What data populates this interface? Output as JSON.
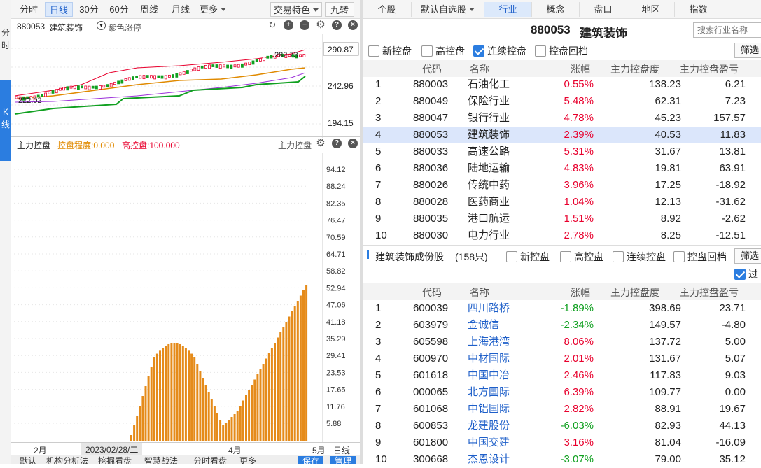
{
  "sidebar": {
    "top_label_1": "分",
    "top_label_2": "时",
    "k_label_1": "K",
    "k_label_2": "线"
  },
  "period_tabs": [
    "分时",
    "日线",
    "30分",
    "60分",
    "周线",
    "月线",
    "更多"
  ],
  "period_active": "日线",
  "period_right": {
    "feature": "交易特色",
    "nine": "九转"
  },
  "kpanel": {
    "code": "880053",
    "name": "建筑装饰",
    "toggle": "紫色涨停",
    "price_top": "290.87",
    "price_mid": "242.96",
    "price_low": "194.15",
    "high_label": "282.73",
    "low_label": "222.02"
  },
  "indicator": {
    "name": "主力控盘",
    "degree": "控盘程度:0.000",
    "high": "高控盘:100.000",
    "right_label": "主力控盘",
    "scale": [
      "94.12",
      "88.24",
      "82.35",
      "76.47",
      "70.59",
      "64.71",
      "58.82",
      "52.94",
      "47.06",
      "41.18",
      "35.29",
      "29.41",
      "23.53",
      "17.65",
      "11.76",
      "5.88"
    ]
  },
  "date_axis": {
    "feb": "2月",
    "cursor": "2023/02/28/二",
    "apr": "4月",
    "may": "5月",
    "period": "日线"
  },
  "bottom_tabs": [
    "默认",
    "机构分析法",
    "挖掘看盘",
    "智慧战法",
    "分时看盘",
    "更多",
    "保存",
    "管理"
  ],
  "right_tabs": [
    "个股",
    "默认自选股",
    "行业",
    "概念",
    "盘口",
    "地区",
    "指数"
  ],
  "right_tab_active": "行业",
  "sector": {
    "code": "880053",
    "name": "建筑装饰",
    "search_placeholder": "搜索行业名称"
  },
  "filters": [
    "新控盘",
    "高控盘",
    "连续控盘",
    "控盘回档"
  ],
  "filter_checked": "连续控盘",
  "filter_button": "筛选",
  "headers": {
    "code": "代码",
    "name": "名称",
    "change": "涨幅",
    "degree": "主力控盘度",
    "profit": "主力控盘盈亏"
  },
  "industry_rows": [
    {
      "idx": "1",
      "code": "880003",
      "name": "石油化工",
      "change": "0.55%",
      "degree": "138.23",
      "profit": "6.21"
    },
    {
      "idx": "2",
      "code": "880049",
      "name": "保险行业",
      "change": "5.48%",
      "degree": "62.31",
      "profit": "7.23"
    },
    {
      "idx": "3",
      "code": "880047",
      "name": "银行行业",
      "change": "4.78%",
      "degree": "45.23",
      "profit": "157.57"
    },
    {
      "idx": "4",
      "code": "880053",
      "name": "建筑装饰",
      "change": "2.39%",
      "degree": "40.53",
      "profit": "11.83"
    },
    {
      "idx": "5",
      "code": "880033",
      "name": "高速公路",
      "change": "5.31%",
      "degree": "31.67",
      "profit": "13.81"
    },
    {
      "idx": "6",
      "code": "880036",
      "name": "陆地运输",
      "change": "4.83%",
      "degree": "19.81",
      "profit": "63.91"
    },
    {
      "idx": "7",
      "code": "880026",
      "name": "传统中药",
      "change": "3.96%",
      "degree": "17.25",
      "profit": "-18.92"
    },
    {
      "idx": "8",
      "code": "880028",
      "name": "医药商业",
      "change": "1.04%",
      "degree": "12.13",
      "profit": "-31.62"
    },
    {
      "idx": "9",
      "code": "880035",
      "name": "港口航运",
      "change": "1.51%",
      "degree": "8.92",
      "profit": "-2.62"
    },
    {
      "idx": "10",
      "code": "880030",
      "name": "电力行业",
      "change": "2.78%",
      "degree": "8.25",
      "profit": "-12.51"
    }
  ],
  "constituents": {
    "title": "建筑装饰成份股",
    "count": "(158只)",
    "filter_tail": "过"
  },
  "stock_rows": [
    {
      "idx": "1",
      "code": "600039",
      "name": "四川路桥",
      "change": "-1.89%",
      "degree": "398.69",
      "profit": "23.71"
    },
    {
      "idx": "2",
      "code": "603979",
      "name": "金诚信",
      "change": "-2.34%",
      "degree": "149.57",
      "profit": "-4.80"
    },
    {
      "idx": "3",
      "code": "605598",
      "name": "上海港湾",
      "change": "8.06%",
      "degree": "137.72",
      "profit": "5.00"
    },
    {
      "idx": "4",
      "code": "600970",
      "name": "中材国际",
      "change": "2.01%",
      "degree": "131.67",
      "profit": "5.07"
    },
    {
      "idx": "5",
      "code": "601618",
      "name": "中国中冶",
      "change": "2.46%",
      "degree": "117.83",
      "profit": "9.03"
    },
    {
      "idx": "6",
      "code": "000065",
      "name": "北方国际",
      "change": "6.39%",
      "degree": "109.77",
      "profit": "0.00"
    },
    {
      "idx": "7",
      "code": "601068",
      "name": "中铝国际",
      "change": "2.82%",
      "degree": "88.91",
      "profit": "19.67"
    },
    {
      "idx": "8",
      "code": "600853",
      "name": "龙建股份",
      "change": "-6.03%",
      "degree": "82.93",
      "profit": "44.13"
    },
    {
      "idx": "9",
      "code": "601800",
      "name": "中国交建",
      "change": "3.16%",
      "degree": "81.04",
      "profit": "-16.09"
    },
    {
      "idx": "10",
      "code": "300668",
      "name": "杰恩设计",
      "change": "-3.07%",
      "degree": "79.00",
      "profit": "35.12"
    }
  ],
  "colors": {
    "up": "#e8002d",
    "down": "#10a020",
    "accent": "#2b7de0",
    "bar": "#e58b1a"
  }
}
